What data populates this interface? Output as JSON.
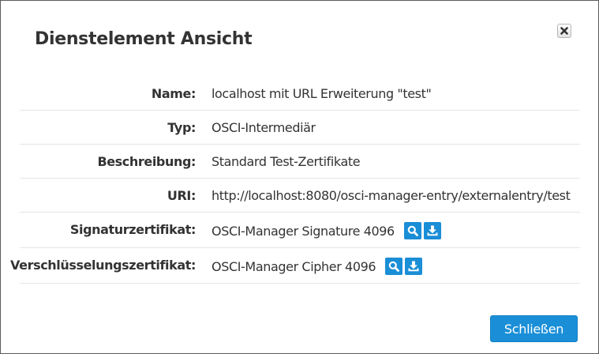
{
  "dialog": {
    "title": "Dienstelement Ansicht",
    "close_icon": "close-x-icon"
  },
  "fields": [
    {
      "label": "Name:",
      "value": "localhost mit URL Erweiterung \"test\""
    },
    {
      "label": "Typ:",
      "value": "OSCI-Intermediär"
    },
    {
      "label": "Beschreibung:",
      "value": "Standard Test-Zertifikate"
    },
    {
      "label": "URI:",
      "value": "http://localhost:8080/osci-manager-entry/externalentry/test"
    },
    {
      "label": "Signaturzertifikat:",
      "value": "OSCI-Manager Signature 4096",
      "actions": [
        "magnifier-icon",
        "download-icon"
      ]
    },
    {
      "label": "Verschlüsselungszertifikat:",
      "value": "OSCI-Manager Cipher 4096",
      "actions": [
        "magnifier-icon",
        "download-icon"
      ]
    }
  ],
  "footer": {
    "close_label": "Schließen"
  },
  "colors": {
    "accent": "#1a8fd8",
    "text": "#333333",
    "divider": "#e5e5e5"
  }
}
